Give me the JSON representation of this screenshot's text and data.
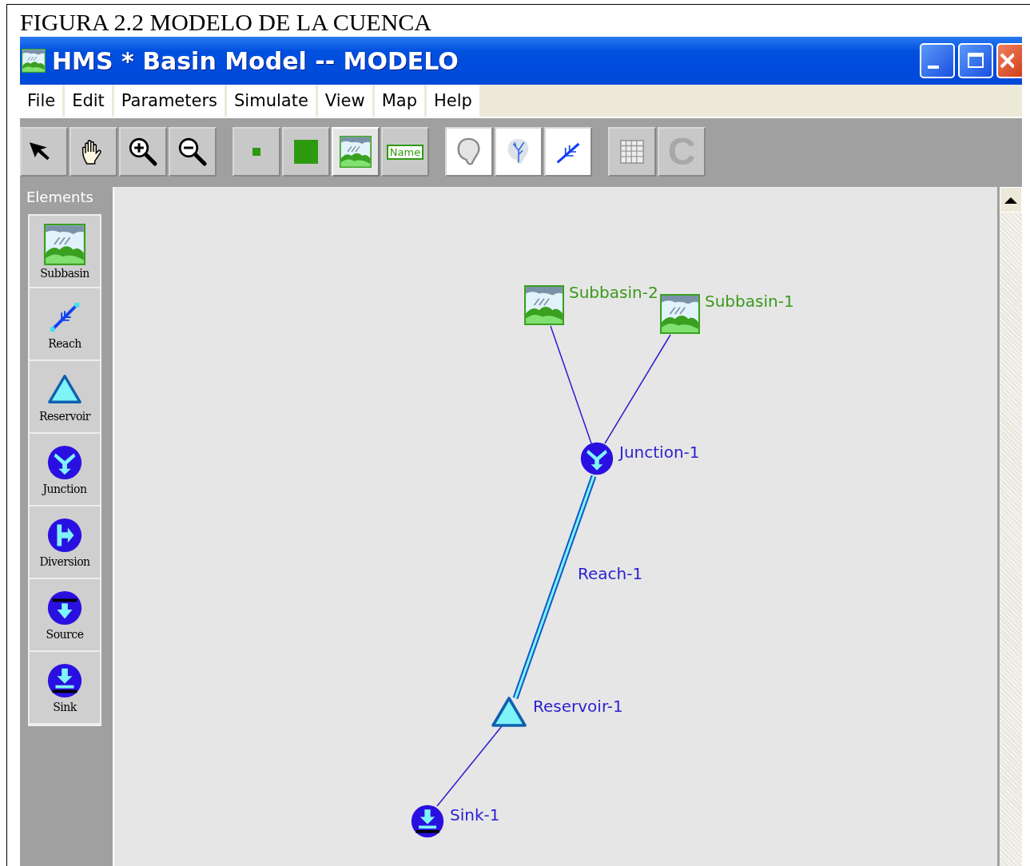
{
  "caption": "FIGURA 2.2  MODELO DE LA CUENCA",
  "window": {
    "title": "HMS * Basin Model -- MODELO"
  },
  "menu": [
    {
      "label": "File"
    },
    {
      "label": "Edit"
    },
    {
      "label": "Parameters"
    },
    {
      "label": "Simulate"
    },
    {
      "label": "View"
    },
    {
      "label": "Map"
    },
    {
      "label": "Help"
    }
  ],
  "toolbar": [
    {
      "kind": "pointer",
      "selected": false
    },
    {
      "kind": "hand",
      "selected": false
    },
    {
      "kind": "zoom-in",
      "selected": false
    },
    {
      "kind": "zoom-out",
      "selected": false
    },
    {
      "kind": "small-square",
      "selected": false
    },
    {
      "kind": "large-square",
      "selected": false
    },
    {
      "kind": "landscape",
      "selected": true
    },
    {
      "kind": "name",
      "label": "Name",
      "selected": false
    },
    {
      "kind": "outline",
      "selected": false
    },
    {
      "kind": "river",
      "selected": false
    },
    {
      "kind": "stream",
      "selected": false
    },
    {
      "kind": "grid",
      "selected": false
    },
    {
      "kind": "letter",
      "label": "C",
      "selected": false
    }
  ],
  "palette": {
    "title": "Elements",
    "items": [
      {
        "kind": "subbasin",
        "label": "Subbasin"
      },
      {
        "kind": "reach",
        "label": "Reach"
      },
      {
        "kind": "reservoir",
        "label": "Reservoir"
      },
      {
        "kind": "junction",
        "label": "Junction"
      },
      {
        "kind": "diversion",
        "label": "Diversion"
      },
      {
        "kind": "source",
        "label": "Source"
      },
      {
        "kind": "sink",
        "label": "Sink"
      }
    ]
  },
  "canvas": {
    "elements": [
      {
        "kind": "subbasin",
        "label": "Subbasin-2"
      },
      {
        "kind": "subbasin",
        "label": "Subbasin-1"
      },
      {
        "kind": "junction",
        "label": "Junction-1"
      },
      {
        "kind": "reach",
        "label": "Reach-1"
      },
      {
        "kind": "reservoir",
        "label": "Reservoir-1"
      },
      {
        "kind": "sink",
        "label": "Sink-1"
      }
    ]
  }
}
